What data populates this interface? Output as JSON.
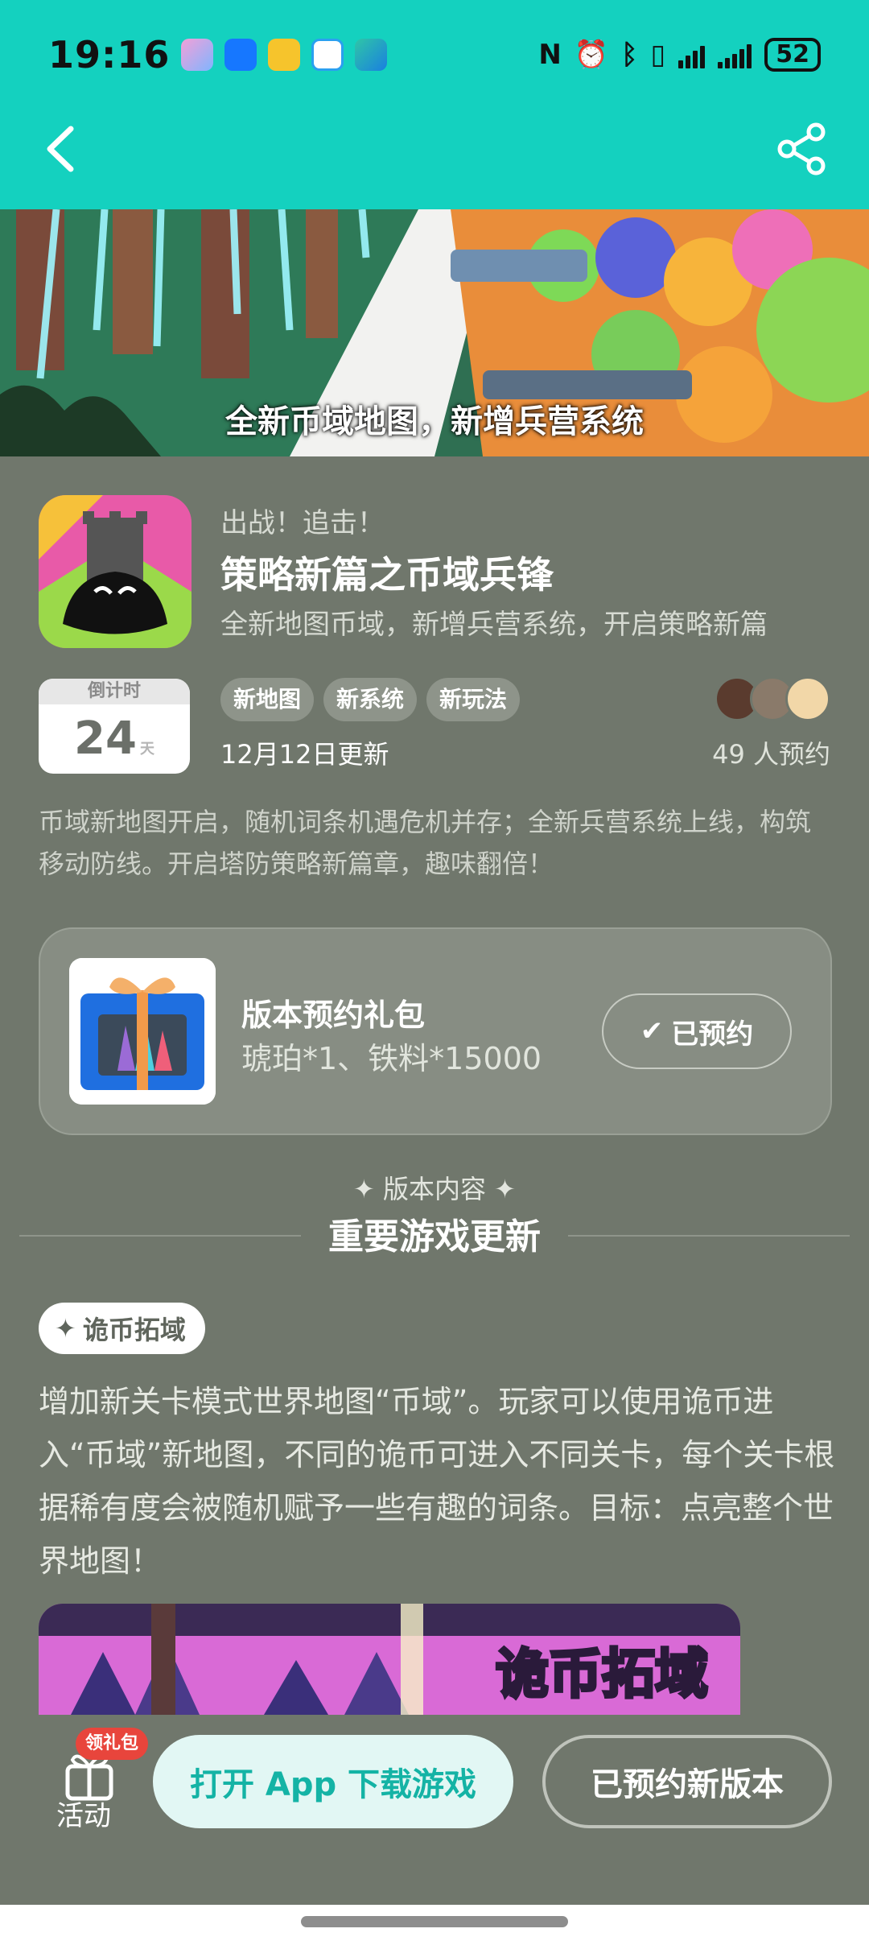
{
  "status_bar": {
    "time": "19:16",
    "battery": "52",
    "app_icons": [
      "browser-icon",
      "alipay-icon",
      "folder-icon",
      "chat-icon",
      "edge-icon"
    ],
    "indicators": [
      "nfc-icon",
      "alarm-icon",
      "bluetooth-icon",
      "vibrate-icon",
      "signal-icon",
      "wifi-signal-icon"
    ]
  },
  "header": {
    "back_icon": "chevron-left-icon",
    "share_icon": "share-icon",
    "background_color": "#14d1bf"
  },
  "banner": {
    "caption": "全新币域地图，新增兵营系统"
  },
  "game": {
    "subtitle": "出战！追击！",
    "title": "策略新篇之币域兵锋",
    "tagline": "全新地图币域，新增兵营系统，开启策略新篇"
  },
  "countdown": {
    "label": "倒计时",
    "value": "24",
    "unit": "天"
  },
  "tags": [
    "新地图",
    "新系统",
    "新玩法"
  ],
  "update_date": "12月12日更新",
  "reservations": "49 人预约",
  "intro": "币域新地图开启，随机词条机遇危机并存；全新兵营系统上线，构筑移动防线。开启塔防策略新篇章，趣味翻倍！",
  "gift": {
    "title": "版本预约礼包",
    "reward": "琥珀*1、铁料*15000",
    "button": "已预约"
  },
  "section": {
    "kicker": "版本内容",
    "title": "重要游戏更新"
  },
  "feature": {
    "chip": "诡币拓域",
    "body": "增加新关卡模式世界地图“币域”。玩家可以使用诡币进入“币域”新地图，不同的诡币可进入不同关卡，每个关卡根据稀有度会被随机赋予一些有趣的词条。目标：点亮整个世界地图！",
    "image_title": "诡币拓域"
  },
  "bottom": {
    "badge": "领礼包",
    "activity_label": "活动",
    "open_button": "打开 App 下载游戏",
    "booked_button": "已预约新版本"
  }
}
